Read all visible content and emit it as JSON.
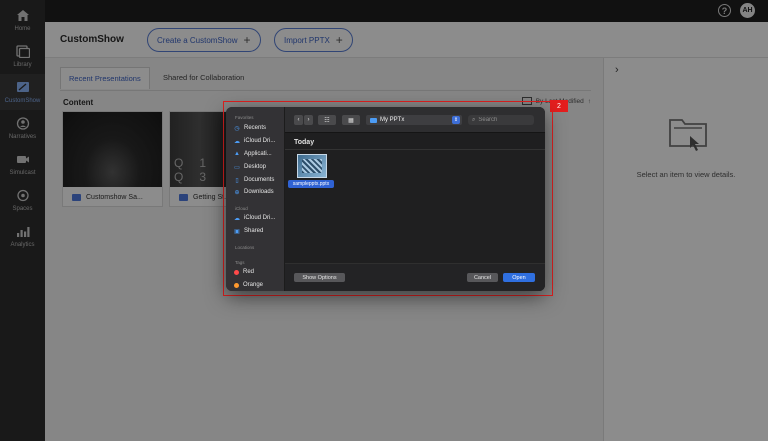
{
  "leftnav": {
    "items": [
      {
        "label": "Home",
        "icon": "home-icon"
      },
      {
        "label": "Library",
        "icon": "library-icon"
      },
      {
        "label": "CustomShow",
        "icon": "customshow-icon"
      },
      {
        "label": "Narratives",
        "icon": "narratives-icon"
      },
      {
        "label": "Simulcast",
        "icon": "simulcast-icon"
      },
      {
        "label": "Spaces",
        "icon": "spaces-icon"
      },
      {
        "label": "Analytics",
        "icon": "analytics-icon"
      }
    ]
  },
  "topbar": {
    "help": "?",
    "avatar": "AH"
  },
  "header": {
    "title": "CustomShow",
    "create_label": "Create a CustomShow",
    "import_label": "Import PPTX",
    "plus": "+"
  },
  "content": {
    "tabs": [
      {
        "label": "Recent Presentations"
      },
      {
        "label": "Shared for Collaboration"
      }
    ],
    "section_label": "Content",
    "sort_label": "By Last Modified",
    "cards": [
      {
        "caption": "Customshow Sa..."
      },
      {
        "caption": "Getting St..."
      }
    ],
    "card2_thumb_text": "Q1 Q3"
  },
  "right_panel": {
    "chevron": "›",
    "empty_text": "Select an item to view details."
  },
  "annotation": {
    "badge": "2",
    "color": "#e02020"
  },
  "dialog": {
    "sidebar": {
      "favorites_label": "Favorites",
      "favorites": [
        {
          "label": "Recents",
          "icon": "clock-icon"
        },
        {
          "label": "iCloud Dri...",
          "icon": "cloud-icon"
        },
        {
          "label": "Applicati...",
          "icon": "apps-icon"
        },
        {
          "label": "Desktop",
          "icon": "desktop-icon"
        },
        {
          "label": "Documents",
          "icon": "document-icon"
        },
        {
          "label": "Downloads",
          "icon": "download-icon"
        }
      ],
      "icloud_label": "iCloud",
      "icloud": [
        {
          "label": "iCloud Dri...",
          "icon": "cloud-icon"
        },
        {
          "label": "Shared",
          "icon": "shared-folder-icon"
        }
      ],
      "locations_label": "Locations",
      "tags_label": "Tags",
      "tags": [
        {
          "label": "Red",
          "color": "#ff4a4a"
        },
        {
          "label": "Orange",
          "color": "#ff9a2e"
        }
      ]
    },
    "toolbar": {
      "back": "‹",
      "forward": "›",
      "view1": "☷",
      "view2": "▦",
      "location": "My PPTx",
      "search_placeholder": "Search"
    },
    "section": "Today",
    "file_name": "samplepptx.pptx",
    "footer": {
      "show_options": "Show Options",
      "cancel": "Cancel",
      "open": "Open"
    }
  }
}
